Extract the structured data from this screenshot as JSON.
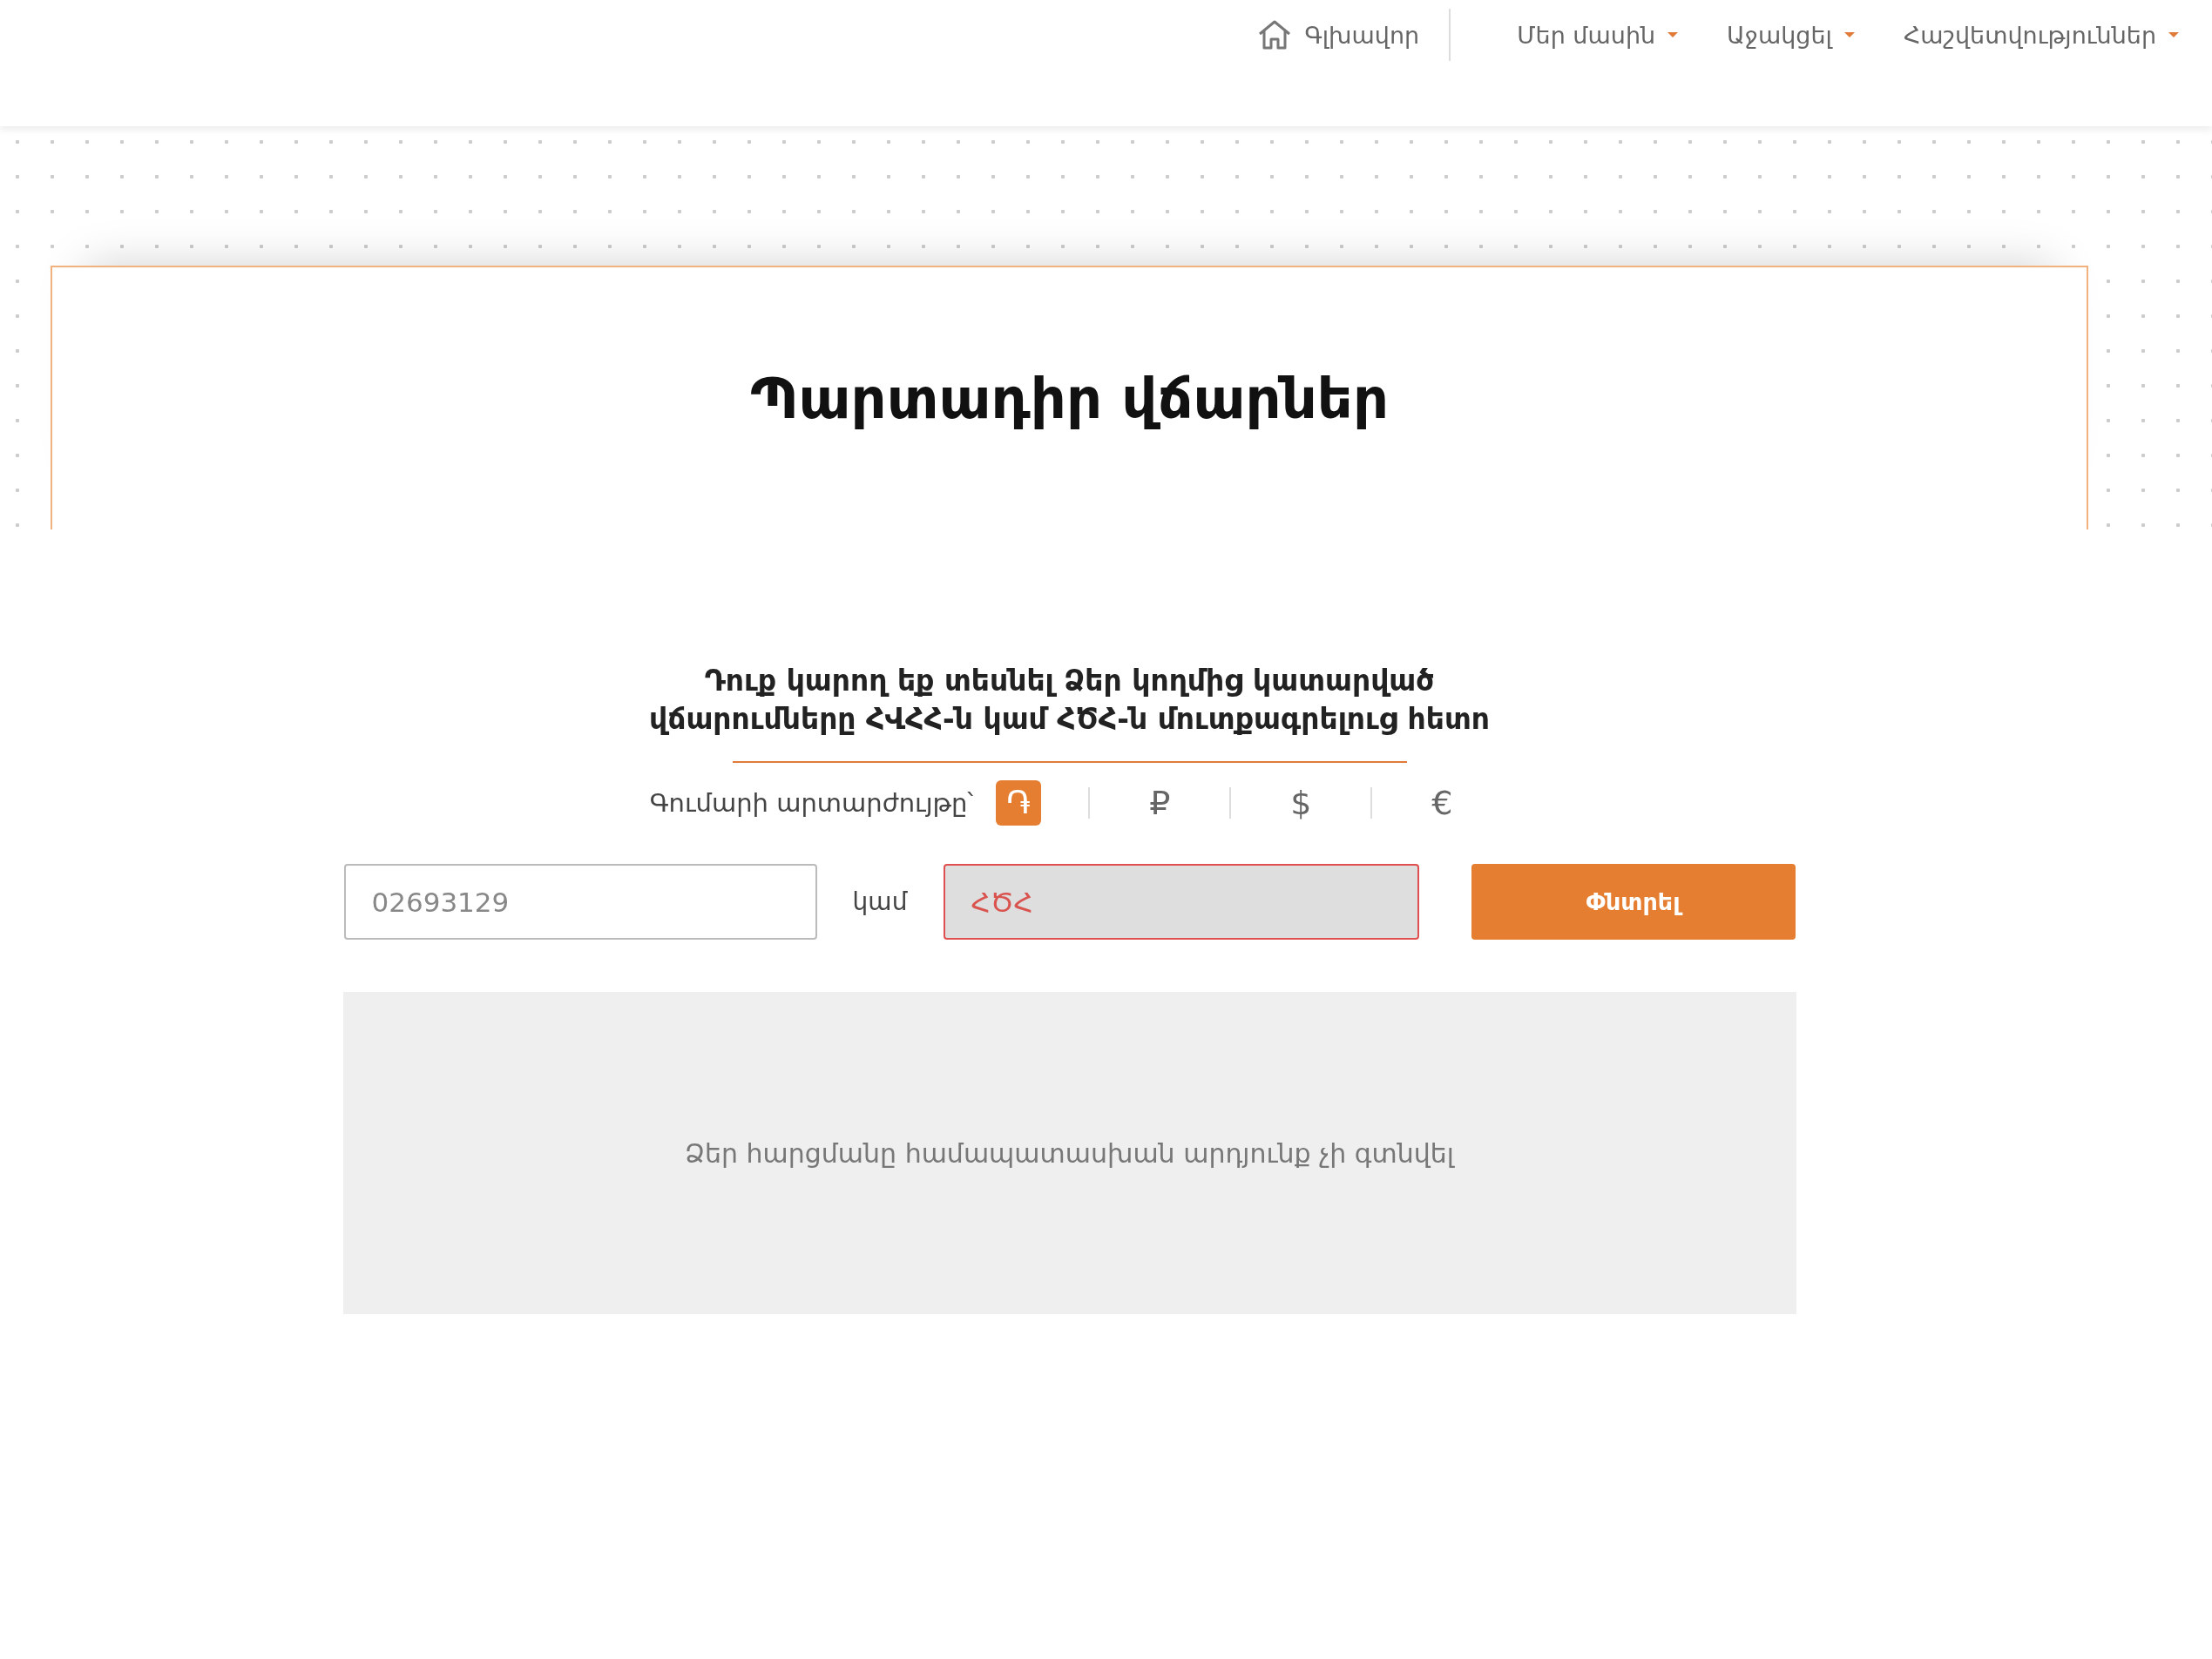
{
  "nav": {
    "items": [
      {
        "label": "Գլխավոր",
        "kind": "home"
      },
      {
        "label": "Մեր մասին",
        "kind": "dropdown"
      },
      {
        "label": "Աջակցել",
        "kind": "dropdown"
      },
      {
        "label": "Հաշվետվություններ",
        "kind": "dropdown"
      }
    ]
  },
  "page": {
    "title": "Պարտադիր վճարներ",
    "subtitle_lines": [
      "Դուք կարող եք տեսնել Ձեր կողմից կատարված",
      "վճարումները ՀՎՀՀ-ն կամ ՀԾՀ-ն մուտքագրելուց հետո"
    ]
  },
  "currency": {
    "label": "Գումարի արտարժույթը՝",
    "options": [
      {
        "symbol": "֏",
        "selected": true
      },
      {
        "symbol": "₽",
        "selected": false
      },
      {
        "symbol": "$",
        "selected": false
      },
      {
        "symbol": "€",
        "selected": false
      }
    ]
  },
  "search": {
    "fields": [
      {
        "placeholder": "02693129",
        "error": false
      },
      {
        "placeholder": "ՀԾՀ",
        "error": true
      }
    ],
    "separator": "կամ",
    "button": "Փնտրել"
  },
  "results": {
    "message": "Ձեր հարցմանը համապատասխան արդյունք չի գտնվել"
  }
}
